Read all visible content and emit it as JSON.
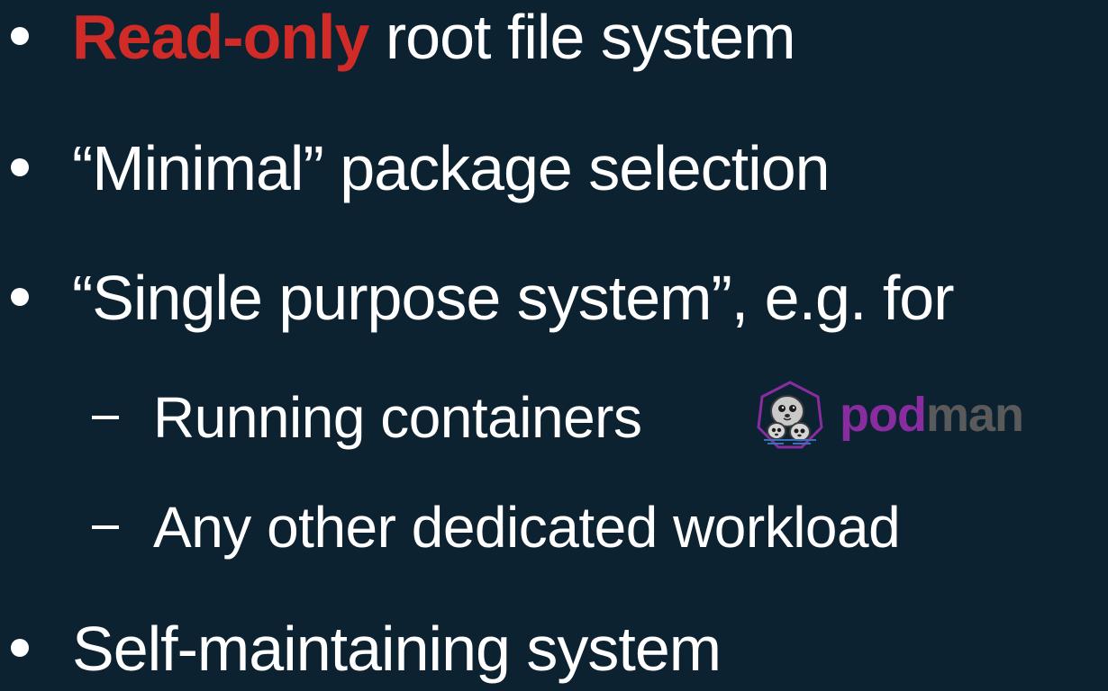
{
  "colors": {
    "background": "#0d2230",
    "text": "#ffffff",
    "highlight": "#d02b26",
    "podman_purple": "#892ca0",
    "podman_gray": "#5a5a5a"
  },
  "bullets": [
    {
      "highlight": "Read-only",
      "text": " root file system"
    },
    {
      "text": "“Minimal” package selection"
    },
    {
      "text": "“Single purpose system”, e.g. for"
    },
    {
      "text": "Self-maintaining system"
    }
  ],
  "sub_bullets": [
    {
      "text": "Running containers"
    },
    {
      "text": "Any other dedicated workload"
    }
  ],
  "logo": {
    "icon": "podman-seals-icon",
    "word_part1": "pod",
    "word_part2": "man"
  }
}
